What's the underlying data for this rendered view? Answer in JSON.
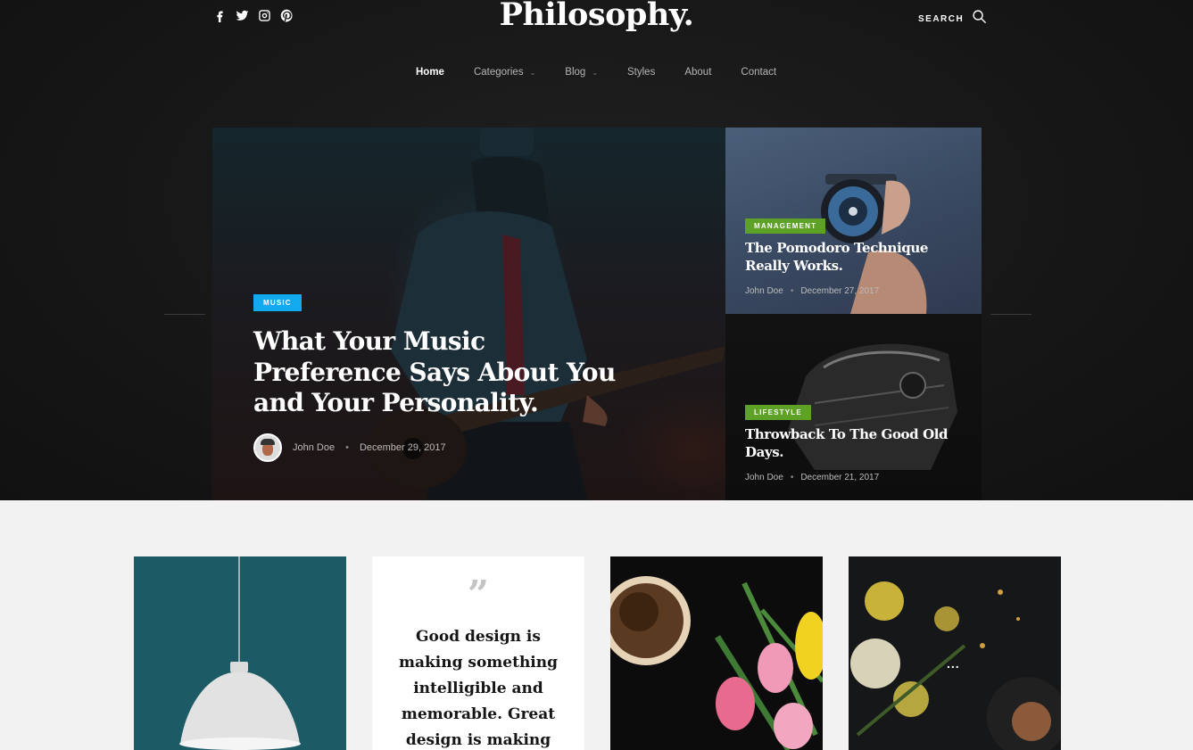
{
  "header": {
    "logo": "Philosophy.",
    "search_label": "SEARCH",
    "social_icons": [
      "facebook-icon",
      "twitter-icon",
      "instagram-icon",
      "pinterest-icon"
    ]
  },
  "nav": {
    "items": [
      {
        "label": "Home",
        "active": true
      },
      {
        "label": "Categories",
        "dropdown": true
      },
      {
        "label": "Blog",
        "dropdown": true
      },
      {
        "label": "Styles"
      },
      {
        "label": "About"
      },
      {
        "label": "Contact"
      }
    ]
  },
  "featured": {
    "main": {
      "category": "MUSIC",
      "title": "What Your Music Preference Says About You and Your Personality.",
      "author": "John Doe",
      "date": "December 29, 2017"
    },
    "side": [
      {
        "category": "MANAGEMENT",
        "title": "The Pomodoro Technique Really Works.",
        "author": "John Doe",
        "date": "December 27, 2017"
      },
      {
        "category": "LIFESTYLE",
        "title": "Throwback To The Good Old Days.",
        "author": "John Doe",
        "date": "December 21, 2017"
      }
    ]
  },
  "grid": {
    "quote": "Good design is making something intelligible and memorable. Great design is making",
    "more_label": "..."
  },
  "colors": {
    "music_badge": "#12a9ef",
    "green_badge": "#5da127",
    "dark_bg": "#161616",
    "light_bg": "#f2f2f2"
  }
}
